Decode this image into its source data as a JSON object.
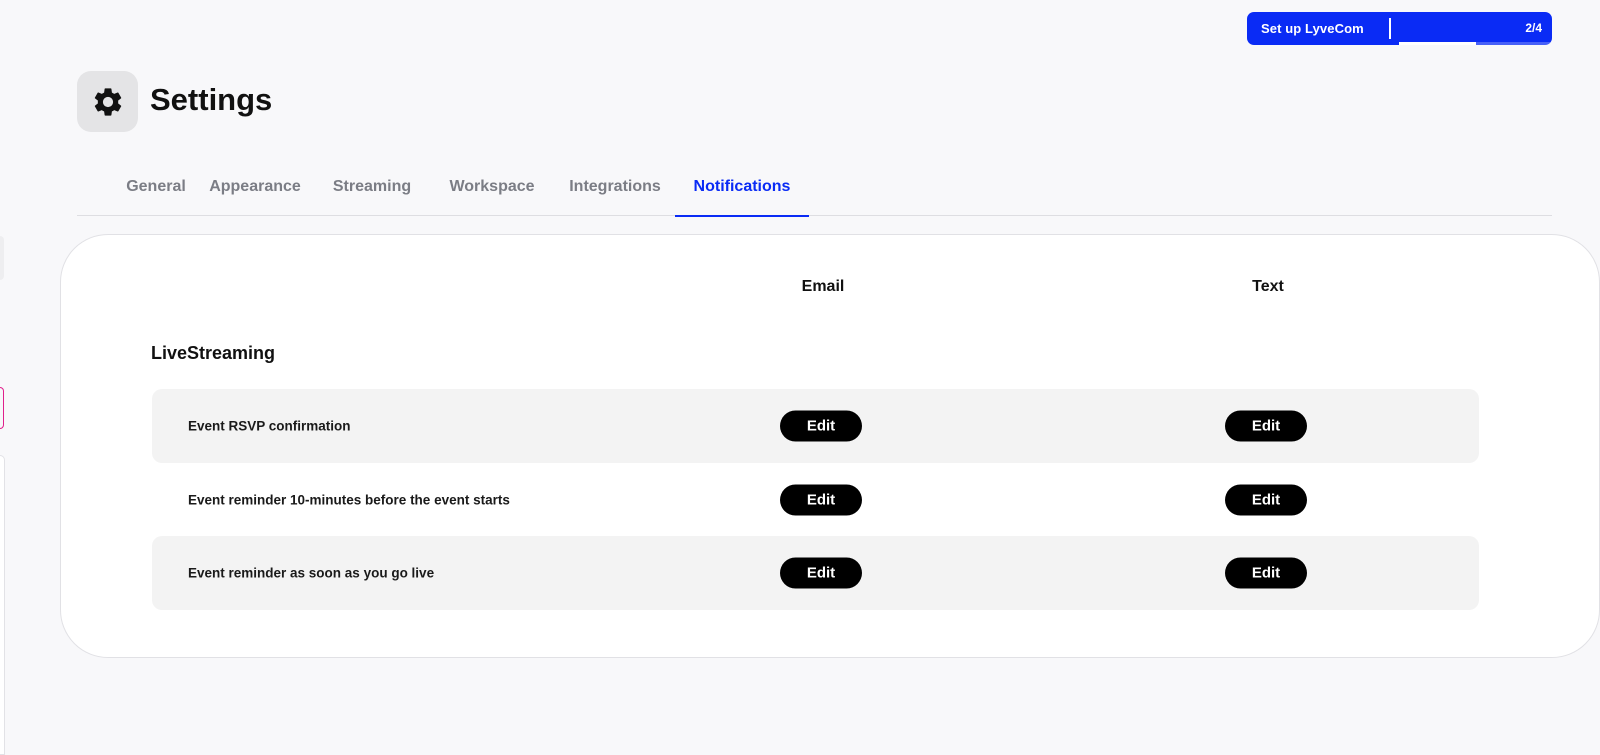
{
  "setup": {
    "label": "Set up LyveCom",
    "count": "2/4",
    "progress": 0.5
  },
  "header": {
    "title": "Settings",
    "icon": "gear-icon"
  },
  "tabs": [
    {
      "label": "General",
      "active": false
    },
    {
      "label": "Appearance",
      "active": false
    },
    {
      "label": "Streaming",
      "active": false
    },
    {
      "label": "Workspace",
      "active": false
    },
    {
      "label": "Integrations",
      "active": false
    },
    {
      "label": "Notifications",
      "active": true
    }
  ],
  "notifications": {
    "columns": {
      "email": "Email",
      "text": "Text"
    },
    "section_title": "LiveStreaming",
    "rows": [
      {
        "label": "Event RSVP confirmation",
        "email_action": "Edit",
        "text_action": "Edit"
      },
      {
        "label": "Event reminder 10-minutes before the event starts",
        "email_action": "Edit",
        "text_action": "Edit"
      },
      {
        "label": "Event reminder as soon as you go live",
        "email_action": "Edit",
        "text_action": "Edit"
      }
    ]
  },
  "colors": {
    "accent": "#0a2bf5",
    "row_shade": "#f3f3f3",
    "button": "#000000"
  }
}
